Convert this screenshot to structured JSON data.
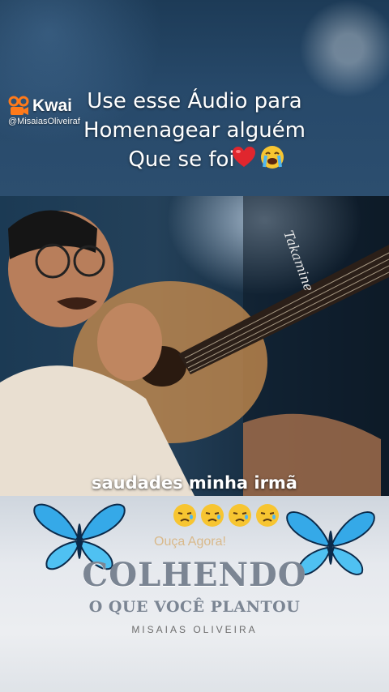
{
  "video": {
    "caption_lines": [
      "Use esse Áudio para",
      "Homenagear alguém",
      "Que se foi"
    ],
    "caption_emojis": [
      "heart-emoji",
      "crying-face-emoji"
    ],
    "overlay_text": "saudades minha irmã",
    "overlay_emojis": [
      "sad-face-emoji",
      "sad-face-emoji",
      "sad-face-emoji",
      "sad-face-emoji"
    ]
  },
  "watermark": {
    "brand": "Kwai",
    "handle": "@MisaiasOliveiraf",
    "icon": "kwai-logo-icon"
  },
  "promo": {
    "label": "Ouça Agora!",
    "album_title": "COLHENDO",
    "album_subtitle": "O QUE VOCÊ PLANTOU",
    "artist": "MISAIAS OLIVEIRA",
    "decoration_icon": "butterfly-icon"
  },
  "colors": {
    "caption_text": "#ffffff",
    "kwai_orange": "#ff7a1a",
    "butterfly_blue": "#35a9e8",
    "title_gray": "#7b8593"
  }
}
